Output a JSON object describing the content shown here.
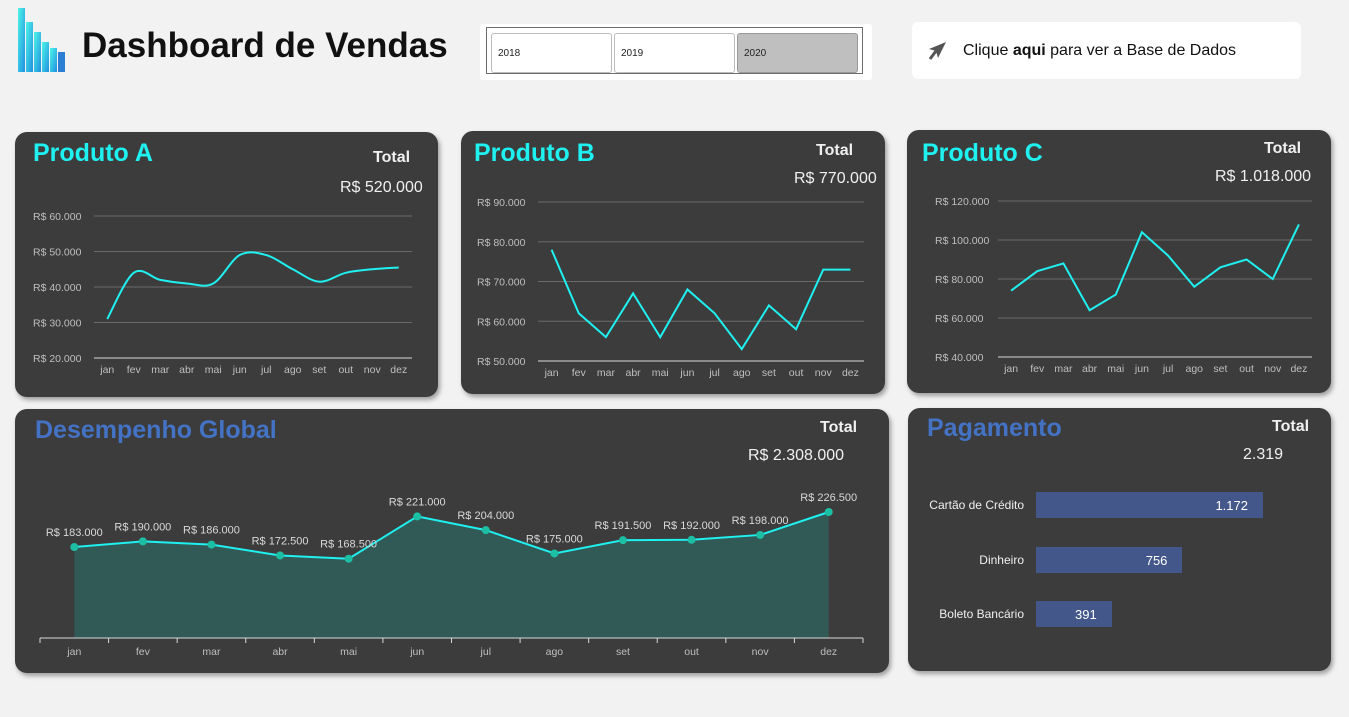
{
  "header": {
    "title": "Dashboard de Vendas",
    "logo_icon": "bar-chart-logo-icon",
    "years": [
      {
        "label": "2018",
        "selected": false
      },
      {
        "label": "2019",
        "selected": false
      },
      {
        "label": "2020",
        "selected": true
      }
    ],
    "db_link": {
      "prefix": "Clique ",
      "bold": "aqui",
      "suffix": " para ver a Base de Dados",
      "icon": "arrow-cursor-icon"
    }
  },
  "colors": {
    "background": "#f2f2f2",
    "panel": "#3c3c3c",
    "line": "#1ff0f0",
    "title_cyan": "#1ff0f0",
    "title_blue": "#4472c4",
    "area_fill": "#315a57",
    "marker": "#1dbfa4",
    "bar": "#44578a"
  },
  "products": [
    {
      "title": "Produto A",
      "total_label": "Total",
      "total": "R$ 520.000"
    },
    {
      "title": "Produto B",
      "total_label": "Total",
      "total": "R$ 770.000"
    },
    {
      "title": "Produto C",
      "total_label": "Total",
      "total": "R$ 1.018.000"
    }
  ],
  "global": {
    "title": "Desempenho Global",
    "total_label": "Total",
    "total": "R$ 2.308.000"
  },
  "payment": {
    "title": "Pagamento",
    "total_label": "Total",
    "total": "2.319"
  },
  "chart_data": [
    {
      "type": "line",
      "x": [
        "jan",
        "fev",
        "mar",
        "abr",
        "mai",
        "jun",
        "jul",
        "ago",
        "set",
        "out",
        "nov",
        "dez"
      ],
      "ylim": [
        20000,
        60000
      ],
      "yticks": [
        {
          "v": 60000,
          "label": "R$ 60.000"
        },
        {
          "v": 50000,
          "label": "R$ 50.000"
        },
        {
          "v": 40000,
          "label": "R$ 40.000"
        },
        {
          "v": 30000,
          "label": "R$ 30.000"
        },
        {
          "v": 20000,
          "label": "R$ 20.000"
        }
      ],
      "smooth": true,
      "values": [
        31000,
        44000,
        42000,
        41000,
        41000,
        49000,
        49000,
        45000,
        41500,
        44000,
        45000,
        45500
      ]
    },
    {
      "type": "line",
      "x": [
        "jan",
        "fev",
        "mar",
        "abr",
        "mai",
        "jun",
        "jul",
        "ago",
        "set",
        "out",
        "nov",
        "dez"
      ],
      "ylim": [
        50000,
        90000
      ],
      "yticks": [
        {
          "v": 90000,
          "label": "R$ 90.000"
        },
        {
          "v": 80000,
          "label": "R$ 80.000"
        },
        {
          "v": 70000,
          "label": "R$ 70.000"
        },
        {
          "v": 60000,
          "label": "R$ 60.000"
        },
        {
          "v": 50000,
          "label": "R$ 50.000"
        }
      ],
      "smooth": false,
      "values": [
        78000,
        62000,
        56000,
        67000,
        56000,
        68000,
        62000,
        53000,
        64000,
        58000,
        73000,
        73000
      ]
    },
    {
      "type": "line",
      "x": [
        "jan",
        "fev",
        "mar",
        "abr",
        "mai",
        "jun",
        "jul",
        "ago",
        "set",
        "out",
        "nov",
        "dez"
      ],
      "ylim": [
        40000,
        120000
      ],
      "yticks": [
        {
          "v": 120000,
          "label": "R$ 120.000"
        },
        {
          "v": 100000,
          "label": "R$ 100.000"
        },
        {
          "v": 80000,
          "label": "R$ 80.000"
        },
        {
          "v": 60000,
          "label": "R$ 60.000"
        },
        {
          "v": 40000,
          "label": "R$ 40.000"
        }
      ],
      "smooth": false,
      "values": [
        74000,
        84000,
        88000,
        64000,
        72000,
        104000,
        92000,
        76000,
        86000,
        90000,
        80000,
        108000
      ]
    },
    {
      "type": "area",
      "x": [
        "jan",
        "fev",
        "mar",
        "abr",
        "mai",
        "jun",
        "jul",
        "ago",
        "set",
        "out",
        "nov",
        "dez"
      ],
      "values": [
        183000,
        190000,
        186000,
        172500,
        168500,
        221000,
        204000,
        175000,
        191500,
        192000,
        198000,
        226500
      ],
      "labels": [
        "R$ 183.000",
        "R$ 190.000",
        "R$ 186.000",
        "R$ 172.500",
        "R$ 168.500",
        "R$ 221.000",
        "R$ 204.000",
        "R$ 175.000",
        "R$ 191.500",
        "R$ 192.000",
        "R$ 198.000",
        "R$ 226.500"
      ]
    },
    {
      "type": "bar",
      "categories": [
        "Cartão de Crédito",
        "Dinheiro",
        "Boleto Bancário"
      ],
      "values": [
        1172,
        756,
        391
      ],
      "labels": [
        "1.172",
        "756",
        "391"
      ]
    }
  ]
}
